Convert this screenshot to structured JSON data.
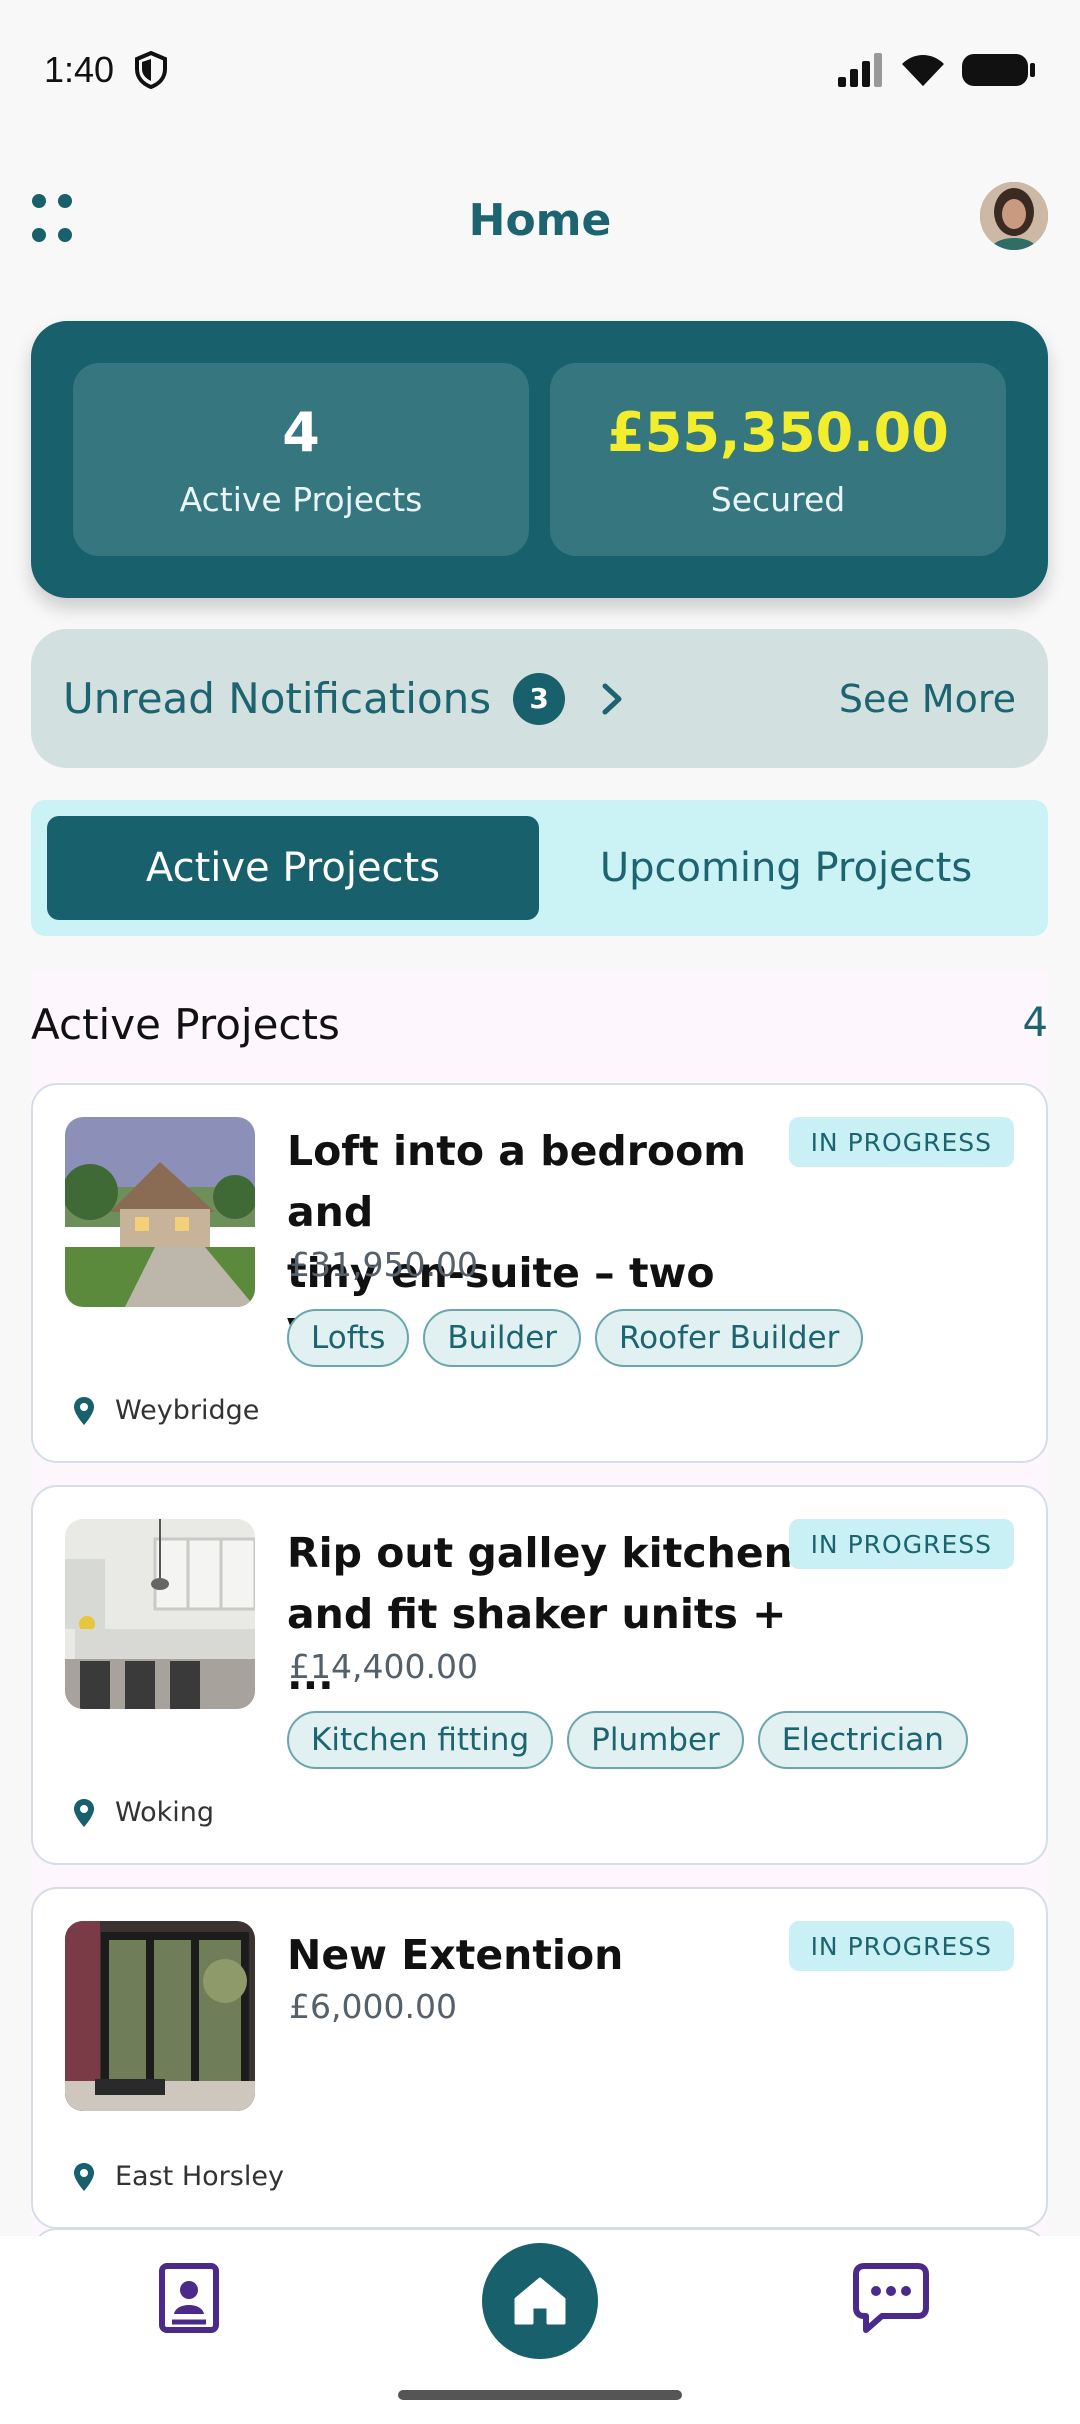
{
  "status_bar": {
    "time": "1:40"
  },
  "header": {
    "title": "Home"
  },
  "stats": {
    "projects_value": "4",
    "projects_label": "Active Projects",
    "secured_value": "£55,350.00",
    "secured_label": "Secured"
  },
  "notifications": {
    "label": "Unread Notifications",
    "count": "3",
    "see_more": "See More"
  },
  "tabs": {
    "active": "Active Projects",
    "upcoming": "Upcoming Projects"
  },
  "section": {
    "title": "Active Projects",
    "count": "4"
  },
  "projects": [
    {
      "title_line1": "Loft into a bedroom and",
      "title_line2": "tiny en-suite – two Vel...",
      "price": "£31,950.00",
      "status": "IN PROGRESS",
      "tags": [
        "Lofts",
        "Builder",
        "Roofer Builder"
      ],
      "location": "Weybridge"
    },
    {
      "title_line1": "Rip out galley kitchen",
      "title_line2": "and fit shaker units + ...",
      "price": "£14,400.00",
      "status": "IN PROGRESS",
      "tags": [
        "Kitchen fitting",
        "Plumber",
        "Electrician"
      ],
      "location": "Woking"
    },
    {
      "title_line1": "New Extention",
      "price": "£6,000.00",
      "status": "IN PROGRESS",
      "location": "East Horsley"
    }
  ],
  "colors": {
    "primary": "#18606c",
    "accent_money": "#f2ee2d",
    "tab_bg": "#cbf2f5"
  }
}
